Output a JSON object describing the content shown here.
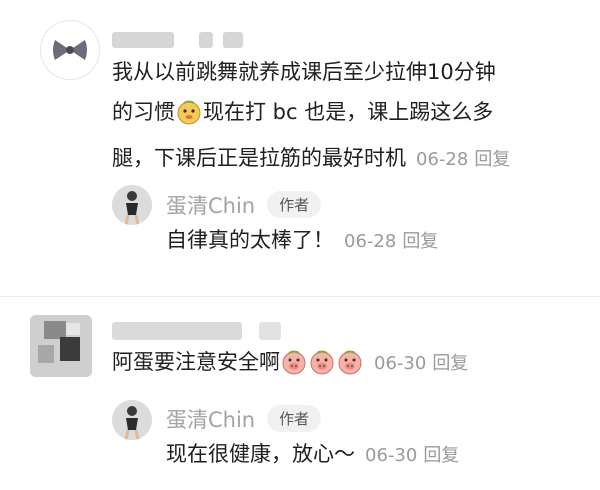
{
  "comments": [
    {
      "text_before_emoji": "我从以前跳舞就养成课后至少拉伸10分钟的习惯",
      "emoji_1": "doge-face-emoji",
      "text_after_emoji": "现在打bc也是，课上踢这么多腿，下课后正是拉筋的最好时机",
      "line1": "我从以前跳舞就养成课后至少拉伸10分钟",
      "line2a": "的习惯",
      "line2b": "现在打 bc 也是，课上踢这么多",
      "line3": "腿，下课后正是拉筋的最好时机",
      "date": "06-28",
      "reply_label": "回复",
      "reply": {
        "author": "蛋清Chin",
        "author_tag": "作者",
        "text": "自律真的太棒了！",
        "date": "06-28",
        "reply_label": "回复"
      }
    },
    {
      "text": "阿蛋要注意安全啊",
      "emoji": [
        "pig-face-emoji",
        "pig-face-emoji",
        "pig-face-emoji"
      ],
      "date": "06-30",
      "reply_label": "回复",
      "reply": {
        "author": "蛋清Chin",
        "author_tag": "作者",
        "text": "现在很健康，放心～",
        "date": "06-30",
        "reply_label": "回复"
      }
    }
  ],
  "colors": {
    "name": "#a3a3a3",
    "meta": "#9a9a9a",
    "tag_bg": "#f1f1f1",
    "text": "#1f1f1f"
  }
}
